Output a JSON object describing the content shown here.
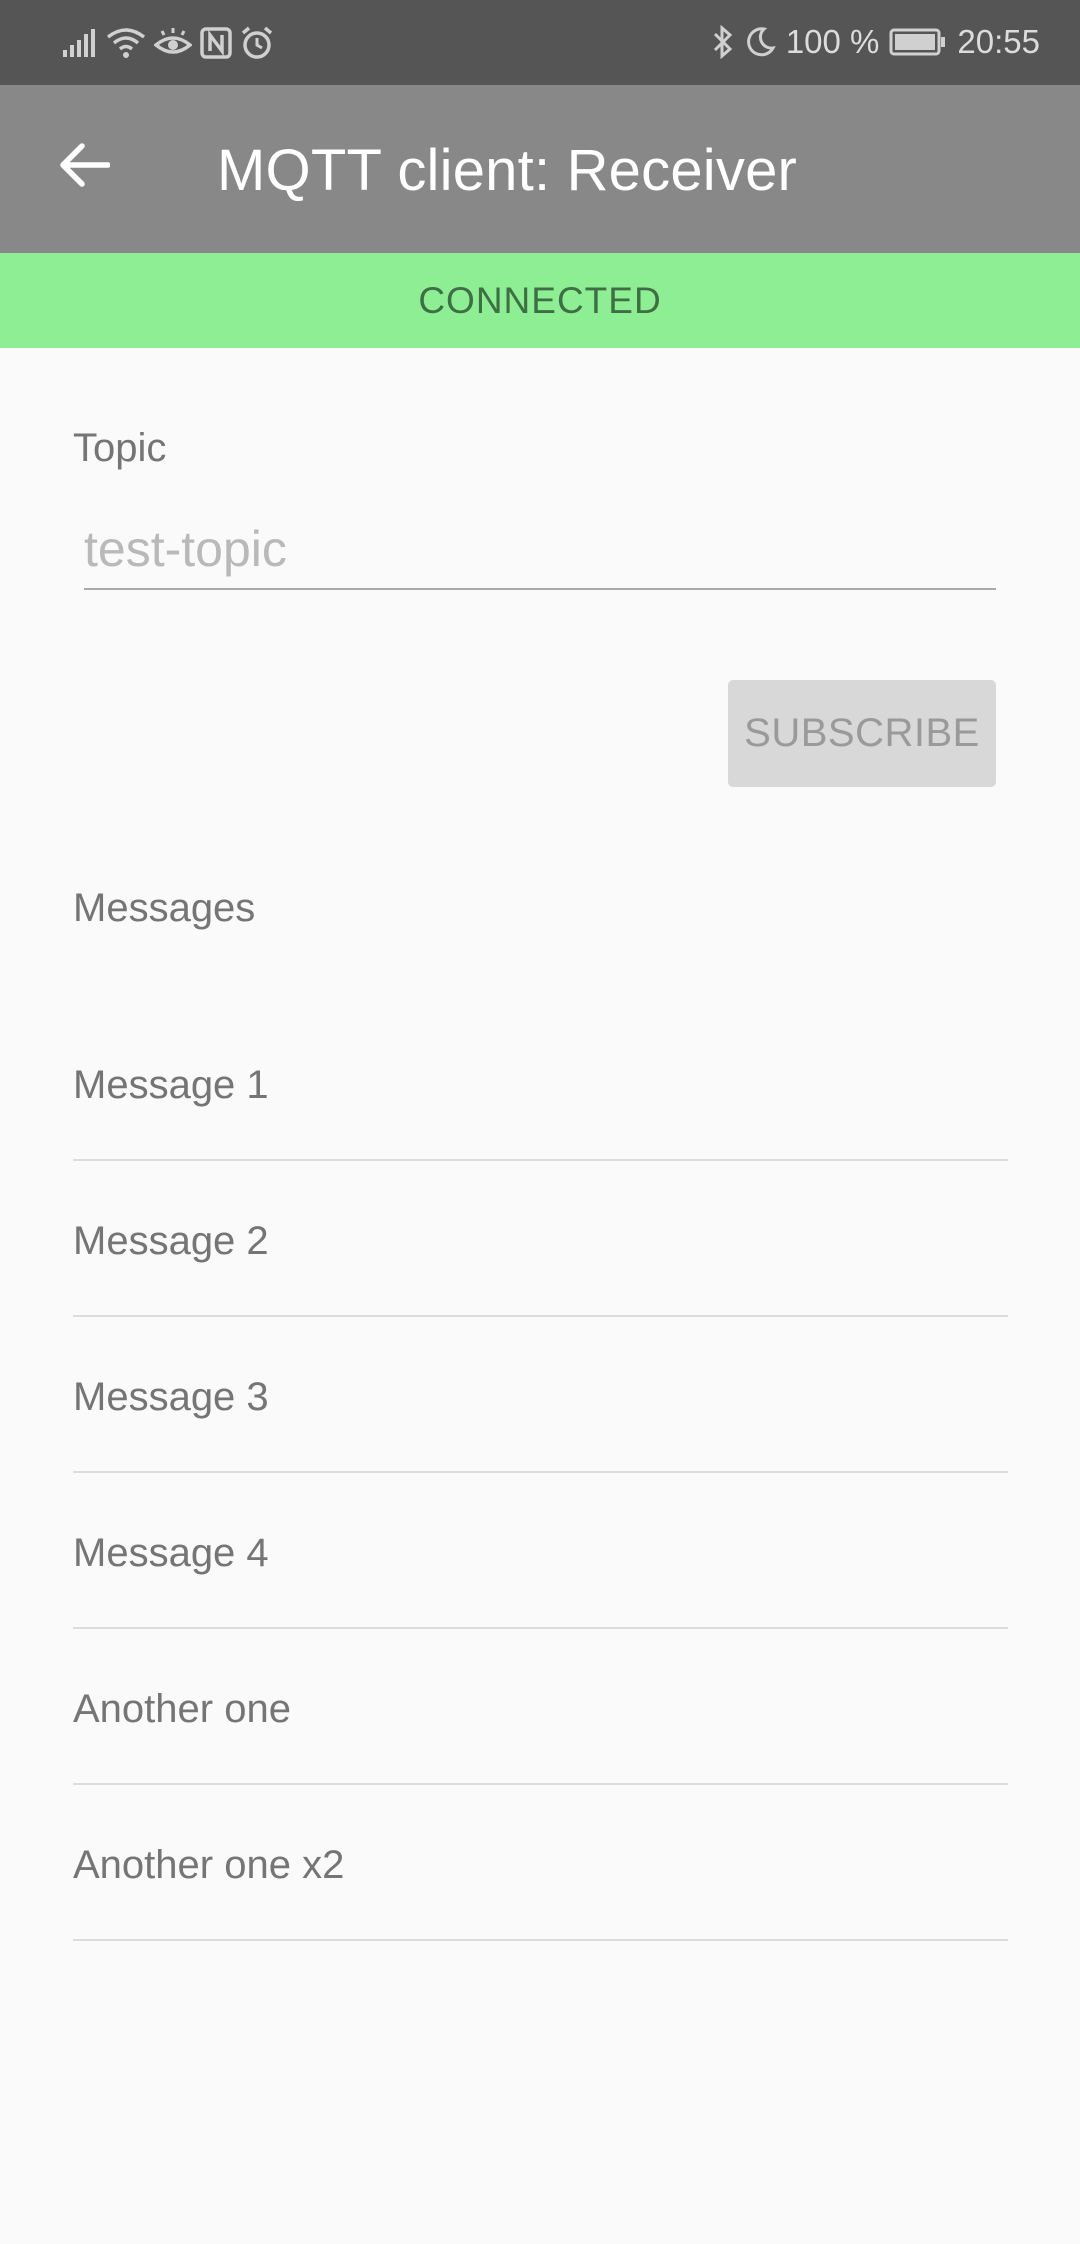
{
  "status_bar": {
    "icons": [
      "signal-icon",
      "wifi-icon",
      "eye-comfort-icon",
      "nfc-icon",
      "alarm-icon",
      "bluetooth-icon",
      "do-not-disturb-icon",
      "battery-icon"
    ],
    "battery": "100 %",
    "time": "20:55"
  },
  "app_bar": {
    "title": "MQTT client: Receiver",
    "back_icon": "arrow-back-icon"
  },
  "connection": {
    "status": "CONNECTED",
    "color": "#8eee93"
  },
  "topic": {
    "label": "Topic",
    "value": "",
    "placeholder": "test-topic"
  },
  "subscribe_button": {
    "label": "SUBSCRIBE"
  },
  "messages": {
    "label": "Messages",
    "items": [
      "Message 1",
      "Message 2",
      "Message 3",
      "Message 4",
      "Another one",
      "Another one x2"
    ]
  },
  "colors": {
    "app_bar": "#888888",
    "status_bar": "#555555",
    "connected_banner": "#8eee93"
  }
}
